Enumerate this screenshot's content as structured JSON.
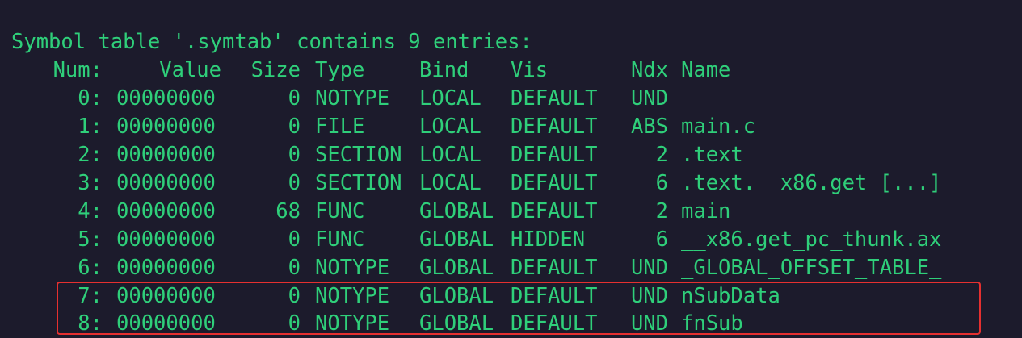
{
  "heading": "Symbol table '.symtab' contains 9 entries:",
  "headers": {
    "num": "Num:",
    "value": "Value",
    "size": "Size",
    "type": "Type",
    "bind": "Bind",
    "vis": "Vis",
    "ndx": "Ndx",
    "name": "Name"
  },
  "rows": [
    {
      "num": "0:",
      "value": "00000000",
      "size": "0",
      "type": "NOTYPE",
      "bind": "LOCAL",
      "vis": "DEFAULT",
      "ndx": "UND",
      "name": ""
    },
    {
      "num": "1:",
      "value": "00000000",
      "size": "0",
      "type": "FILE",
      "bind": "LOCAL",
      "vis": "DEFAULT",
      "ndx": "ABS",
      "name": "main.c"
    },
    {
      "num": "2:",
      "value": "00000000",
      "size": "0",
      "type": "SECTION",
      "bind": "LOCAL",
      "vis": "DEFAULT",
      "ndx": "2",
      "name": ".text"
    },
    {
      "num": "3:",
      "value": "00000000",
      "size": "0",
      "type": "SECTION",
      "bind": "LOCAL",
      "vis": "DEFAULT",
      "ndx": "6",
      "name": ".text.__x86.get_[...]"
    },
    {
      "num": "4:",
      "value": "00000000",
      "size": "68",
      "type": "FUNC",
      "bind": "GLOBAL",
      "vis": "DEFAULT",
      "ndx": "2",
      "name": "main"
    },
    {
      "num": "5:",
      "value": "00000000",
      "size": "0",
      "type": "FUNC",
      "bind": "GLOBAL",
      "vis": "HIDDEN",
      "ndx": "6",
      "name": "__x86.get_pc_thunk.ax"
    },
    {
      "num": "6:",
      "value": "00000000",
      "size": "0",
      "type": "NOTYPE",
      "bind": "GLOBAL",
      "vis": "DEFAULT",
      "ndx": "UND",
      "name": "_GLOBAL_OFFSET_TABLE_"
    },
    {
      "num": "7:",
      "value": "00000000",
      "size": "0",
      "type": "NOTYPE",
      "bind": "GLOBAL",
      "vis": "DEFAULT",
      "ndx": "UND",
      "name": "nSubData"
    },
    {
      "num": "8:",
      "value": "00000000",
      "size": "0",
      "type": "NOTYPE",
      "bind": "GLOBAL",
      "vis": "DEFAULT",
      "ndx": "UND",
      "name": "fnSub"
    }
  ],
  "highlighted_rows": [
    "7:",
    "8:"
  ],
  "colors": {
    "background": "#1c1b2c",
    "text": "#2fcf7a",
    "highlight_border": "#e53030"
  }
}
